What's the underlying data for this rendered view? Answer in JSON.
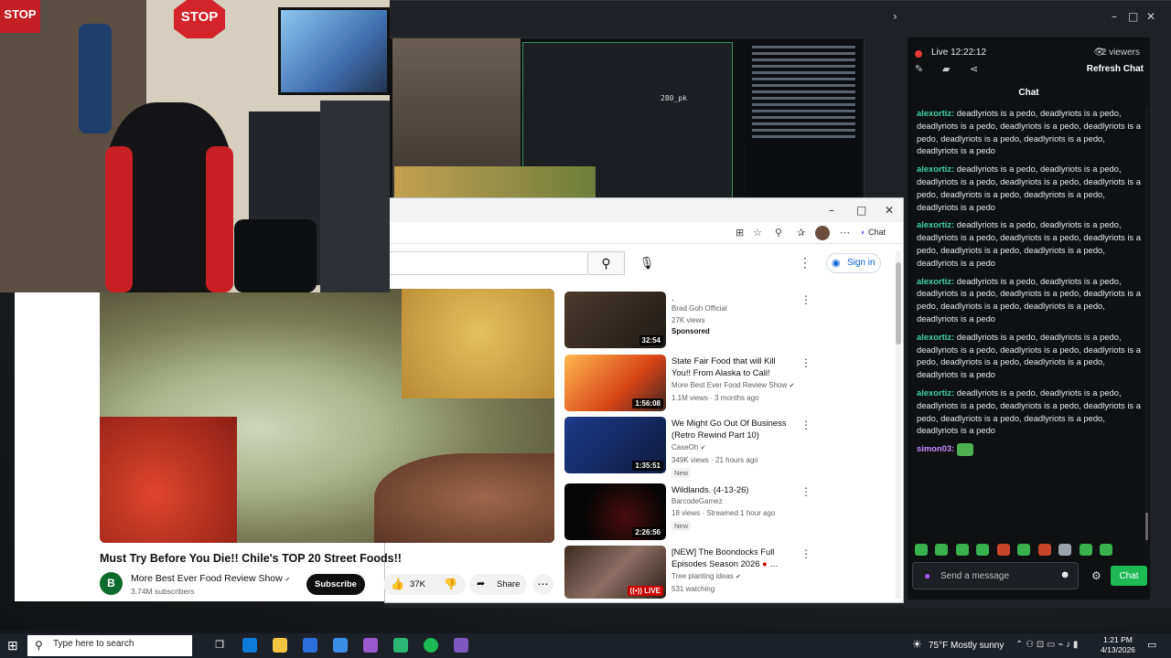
{
  "stream_app": {
    "live_label": "Live 12:22:12",
    "viewers": "2 viewers",
    "refresh_chat": "Refresh Chat",
    "chat_header": "Chat",
    "messages": [
      {
        "user": "alexortiz:",
        "text": " deadlyriots is a pedo, deadlyriots is a pedo, deadlyriots is a pedo, deadlyriots is a pedo, deadlyriots is a pedo, deadlyriots is a pedo, deadlyriots is a pedo, deadlyriots is a pedo"
      },
      {
        "user": "alexortiz:",
        "text": " deadlyriots is a pedo, deadlyriots is a pedo, deadlyriots is a pedo, deadlyriots is a pedo, deadlyriots is a pedo, deadlyriots is a pedo, deadlyriots is a pedo, deadlyriots is a pedo"
      },
      {
        "user": "alexortiz:",
        "text": " deadlyriots is a pedo, deadlyriots is a pedo, deadlyriots is a pedo, deadlyriots is a pedo, deadlyriots is a pedo, deadlyriots is a pedo, deadlyriots is a pedo, deadlyriots is a pedo"
      },
      {
        "user": "alexortiz:",
        "text": " deadlyriots is a pedo, deadlyriots is a pedo, deadlyriots is a pedo, deadlyriots is a pedo, deadlyriots is a pedo, deadlyriots is a pedo, deadlyriots is a pedo, deadlyriots is a pedo"
      },
      {
        "user": "alexortiz:",
        "text": " deadlyriots is a pedo, deadlyriots is a pedo, deadlyriots is a pedo, deadlyriots is a pedo, deadlyriots is a pedo, deadlyriots is a pedo, deadlyriots is a pedo, deadlyriots is a pedo"
      },
      {
        "user": "alexortiz:",
        "text": " deadlyriots is a pedo, deadlyriots is a pedo, deadlyriots is a pedo, deadlyriots is a pedo, deadlyriots is a pedo, deadlyriots is a pedo, deadlyriots is a pedo, deadlyriots is a pedo"
      }
    ],
    "last_user": "simon03:",
    "message_placeholder": "Send a message",
    "send_label": "Chat",
    "accent": "#1db954"
  },
  "preview": {
    "overlay_text": "280_pk"
  },
  "webcam": {
    "stop_text": "STOP",
    "stop_text_2": "STOP"
  },
  "browser": {
    "copilot_chip": "Chat",
    "signin_label": "Sign in",
    "video": {
      "title": "Must Try Before You Die!! Chile's TOP 20 Street Foods!!",
      "channel": "More Best Ever Food Review Show",
      "subscribers": "3.74M subscribers",
      "subscribe_label": "Subscribe",
      "likes": "37K",
      "share_label": "Share",
      "avatar_letter": "B"
    },
    "recommendations": [
      {
        "title": ".",
        "channel": "Brad Goh Official",
        "meta": "27K views",
        "extra": "Sponsored",
        "duration": "32:54",
        "kind": "sponsored"
      },
      {
        "title": "State Fair Food that will Kill You!! From Alaska to Cali!",
        "channel": "More Best Ever Food Review Show",
        "meta": "1.1M views · 3 months ago",
        "extra": "",
        "duration": "1:56:08",
        "kind": "normal"
      },
      {
        "title": "We Might Go Out Of Business (Retro Rewind Part 10)",
        "channel": "CaseOh",
        "meta": "349K views · 21 hours ago",
        "extra": "New",
        "duration": "1:35:51",
        "kind": "new"
      },
      {
        "title": "Wildlands. (4-13-26)",
        "channel": "BarcodeGamez",
        "meta": "18 views · Streamed 1 hour ago",
        "extra": "New",
        "duration": "2:26:56",
        "kind": "new"
      },
      {
        "title": "[NEW] The Boondocks Full Episodes Season 2026",
        "channel": "Tree planting ideas",
        "meta": "531 watching",
        "extra": "",
        "duration": "LIVE",
        "kind": "live"
      }
    ]
  },
  "taskbar": {
    "search_placeholder": "Type here to search",
    "weather": "75°F  Mostly sunny",
    "time": "1:21 PM",
    "date": "4/13/2026"
  }
}
